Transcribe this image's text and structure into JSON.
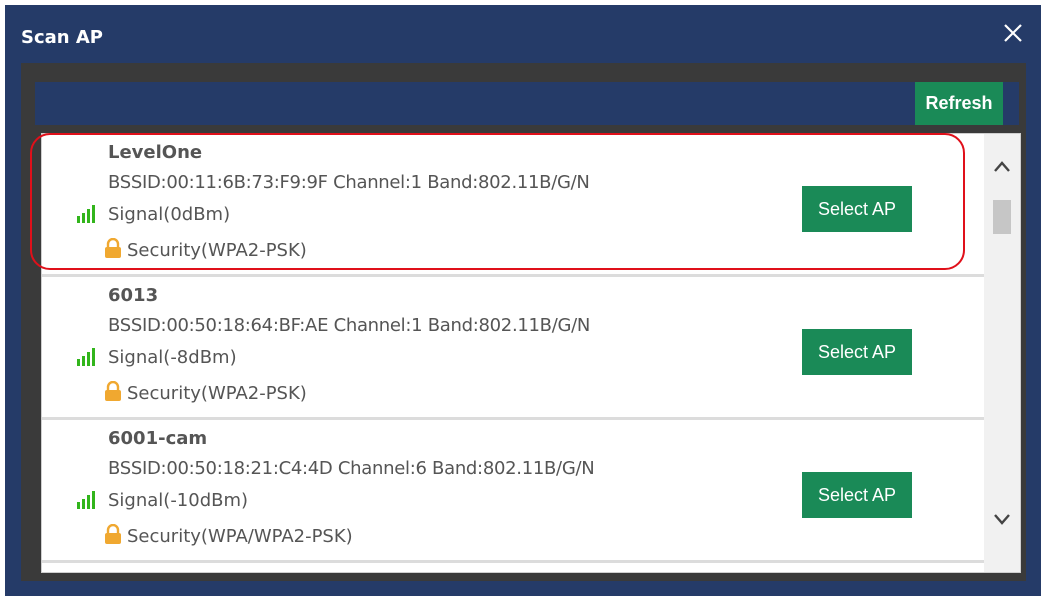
{
  "dialog": {
    "title": "Scan AP",
    "close_label": "×"
  },
  "toolbar": {
    "refresh_label": "Refresh"
  },
  "access_points": [
    {
      "name": "LevelOne",
      "detail": "BSSID:00:11:6B:73:F9:9F Channel:1 Band:802.11B/G/N",
      "signal": "Signal(0dBm)",
      "security": "Security(WPA2-PSK)",
      "select_label": "Select AP"
    },
    {
      "name": "6013",
      "detail": "BSSID:00:50:18:64:BF:AE Channel:1 Band:802.11B/G/N",
      "signal": "Signal(-8dBm)",
      "security": "Security(WPA2-PSK)",
      "select_label": "Select AP"
    },
    {
      "name": "6001-cam",
      "detail": "BSSID:00:50:18:21:C4:4D Channel:6 Band:802.11B/G/N",
      "signal": "Signal(-10dBm)",
      "security": "Security(WPA/WPA2-PSK)",
      "select_label": "Select AP"
    }
  ],
  "colors": {
    "header": "#253b68",
    "button": "#1a8a57",
    "highlight": "#e0101a",
    "signal": "#32b51c",
    "lock": "#f0a830"
  },
  "icons": {
    "close": "close-icon",
    "signal": "signal-strength-icon",
    "lock": "lock-icon",
    "scroll_up": "chevron-up-icon",
    "scroll_down": "chevron-down-icon"
  }
}
